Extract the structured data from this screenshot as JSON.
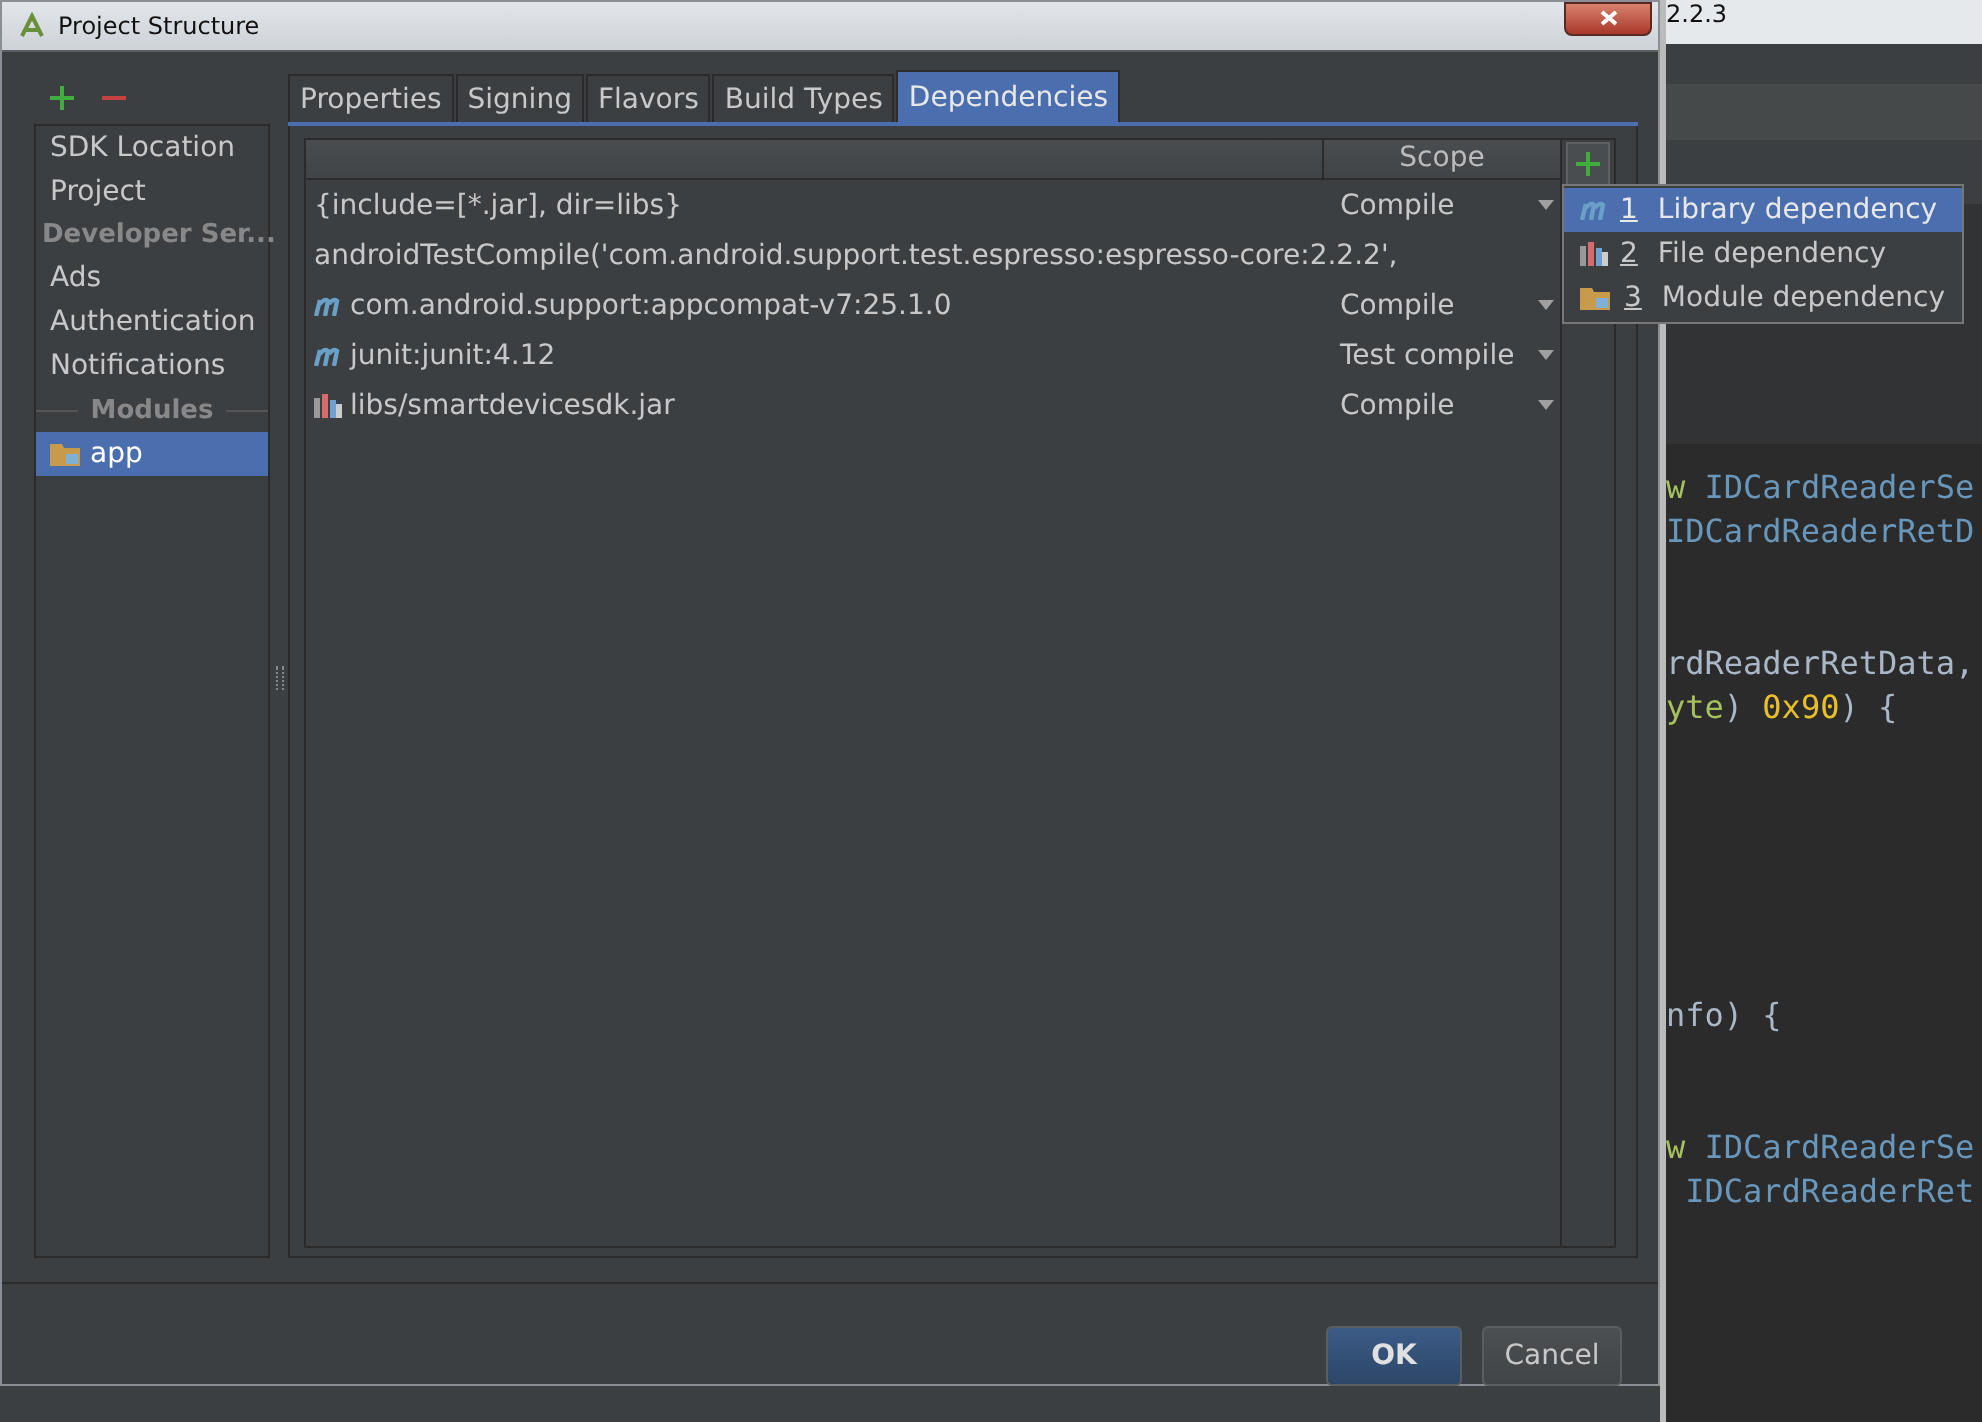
{
  "window": {
    "title": "Project Structure"
  },
  "sidebar": {
    "items": [
      {
        "kind": "item",
        "label": "SDK Location",
        "selected": false
      },
      {
        "kind": "item",
        "label": "Project",
        "selected": false
      },
      {
        "kind": "header",
        "label": "Developer Ser..."
      },
      {
        "kind": "item",
        "label": "Ads",
        "selected": false
      },
      {
        "kind": "item",
        "label": "Authentication",
        "selected": false
      },
      {
        "kind": "item",
        "label": "Notifications",
        "selected": false
      },
      {
        "kind": "section",
        "label": "Modules"
      },
      {
        "kind": "module",
        "label": "app",
        "selected": true
      }
    ]
  },
  "tabs": [
    {
      "label": "Properties",
      "selected": false
    },
    {
      "label": "Signing",
      "selected": false
    },
    {
      "label": "Flavors",
      "selected": false
    },
    {
      "label": "Build Types",
      "selected": false
    },
    {
      "label": "Dependencies",
      "selected": true
    }
  ],
  "table": {
    "columns": [
      {
        "label": "Scope"
      }
    ],
    "rows": [
      {
        "kind": "plain",
        "name": "{include=[*.jar], dir=libs}",
        "scope": "Compile"
      },
      {
        "kind": "plain",
        "name": "androidTestCompile('com.android.support.test.espresso:espresso-core:2.2.2',"
      },
      {
        "kind": "library",
        "name": "com.android.support:appcompat-v7:25.1.0",
        "scope": "Compile"
      },
      {
        "kind": "library",
        "name": "junit:junit:4.12",
        "scope": "Test compile"
      },
      {
        "kind": "jar",
        "name": "libs/smartdevicesdk.jar",
        "scope": "Compile"
      }
    ]
  },
  "add_menu": {
    "items": [
      {
        "kind": "library",
        "number": "1",
        "label": "Library dependency",
        "selected": true
      },
      {
        "kind": "jar",
        "number": "2",
        "label": "File dependency",
        "selected": false
      },
      {
        "kind": "module",
        "number": "3",
        "label": "Module dependency",
        "selected": false
      }
    ]
  },
  "buttons": [
    {
      "kind": "primary",
      "label": "OK"
    },
    {
      "kind": "normal",
      "label": "Cancel"
    }
  ],
  "background_editor": {
    "version": "2.2.3",
    "lines": [
      {
        "kind": "code",
        "tokens": [
          {
            "kind": "keyword",
            "text": "w"
          },
          {
            "kind": "type",
            "text": " IDCardReaderSe"
          }
        ]
      },
      {
        "kind": "code",
        "tokens": [
          {
            "kind": "type",
            "text": "IDCardReaderRetD"
          }
        ]
      },
      {
        "kind": "blank"
      },
      {
        "kind": "blank"
      },
      {
        "kind": "code",
        "tokens": [
          {
            "kind": "plain",
            "text": "rdReaderRetData,"
          }
        ]
      },
      {
        "kind": "code",
        "tokens": [
          {
            "kind": "keyword",
            "text": "yte"
          },
          {
            "kind": "plain",
            "text": ") "
          },
          {
            "kind": "number",
            "text": "0x90"
          },
          {
            "kind": "plain",
            "text": ") {"
          }
        ]
      },
      {
        "kind": "blank"
      },
      {
        "kind": "blank"
      },
      {
        "kind": "blank"
      },
      {
        "kind": "blank"
      },
      {
        "kind": "blank"
      },
      {
        "kind": "blank"
      },
      {
        "kind": "code",
        "tokens": [
          {
            "kind": "plain",
            "text": "nfo) {"
          }
        ]
      },
      {
        "kind": "blank"
      },
      {
        "kind": "blank"
      },
      {
        "kind": "code",
        "tokens": [
          {
            "kind": "keyword",
            "text": "w"
          },
          {
            "kind": "type",
            "text": " IDCardReaderSe"
          }
        ]
      },
      {
        "kind": "code",
        "tokens": [
          {
            "kind": "type",
            "text": " IDCardReaderRet"
          }
        ]
      }
    ]
  }
}
